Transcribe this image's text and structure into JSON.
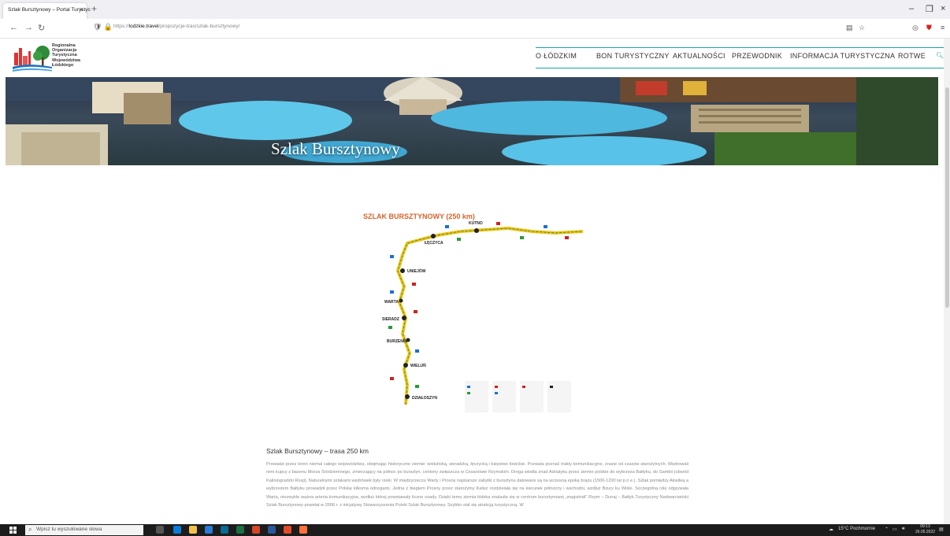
{
  "browser": {
    "tab_title": "Szlak Bursztynowy – Portal Turystyc",
    "url_prefix": "https://",
    "url_domain": "lodzkie.travel",
    "url_path": "/propozycje-tras/szlak-bursztynowy/"
  },
  "site": {
    "logo_lines": [
      "Regionalna",
      "Organizacja",
      "Turystyczna",
      "Województwa",
      "Łódzkiego"
    ],
    "nav": [
      "O ŁÓDZKIM",
      "BON TURYSTYCZNY",
      "AKTUALNOŚCI",
      "PRZEWODNIK",
      "INFORMACJA TURYSTYCZNA",
      "ROTWE"
    ]
  },
  "hero": {
    "title": "Szlak Bursztynowy"
  },
  "map": {
    "title": "SZLAK BURSZTYNOWY (250 km)",
    "towns": [
      "KUTNO",
      "ŁĘCZYCA",
      "UNIEJÓW",
      "SIERADZ",
      "WARTA",
      "WIELUŃ",
      "BURZENIN",
      "DZIAŁOSZYN"
    ]
  },
  "article": {
    "title": "Szlak Bursztynowy – trasa 250 km",
    "body": "Prowadzi przez teren niemal całego województwa, obejmując historyczne ziemie: wieluńską, sieradzką, łęczycką i księstwo łowickie. Pozwala poznać trakty komunikacyjne, znane od czasów starożytnych. Wędrowali nimi kupcy z basenu Morza Śródziemnego, zmierzający na północ po bursztyn, ceniony zwłaszcza w Cesarstwie Rzymskim. Droga wiodła znad Adriatyku przez ziemie polskie do wybrzeża Bałtyku, do Sambii (obwód Kaliningradzki Rosji). Naturalnymi szlakami wędrówek były rzeki. W międzyrzeczu Warty i Prosny najstarsze zabytki z bursztynu datowane są na wczesną epokę brązu (1500-1200 lat p.n.e.). Szlak pomiędzy Akwileą a wybrzeżem Bałtyku prowadził przez Polskę kilkoma odnogami. Jedna z biegiem Prosny przez starożytny Kalisz rozdzielała się na kierunek północny i wschodni, wzdłuż Bzury ku Wiśle. Szczególną rolę odgrywała Warta, niezwykle ważna arteria komunikacyjna, wzdłuż której powstawały liczne osady. Dzięki temu ziemia łódzka znalazła się w centrum bursztynowej „magistrali\" Rzym – Dunaj – Bałtyk.Turystyczny Nadwarciański Szlak Bursztynowy powstał w 2006 r. z inicjatywy Stowarzyszenia Polski Szlak Bursztynowy. Szybko stał się atrakcją turystyczną. W"
  },
  "taskbar": {
    "search_placeholder": "Wpisz tu wyszukiwane słowa",
    "weather": "15°C Pochmurnie",
    "time": "09:13",
    "date": "26.05.2022"
  },
  "colors": {
    "accent": "#1aa3a3",
    "map_title": "#d9632a",
    "route": "#f2c20a"
  }
}
